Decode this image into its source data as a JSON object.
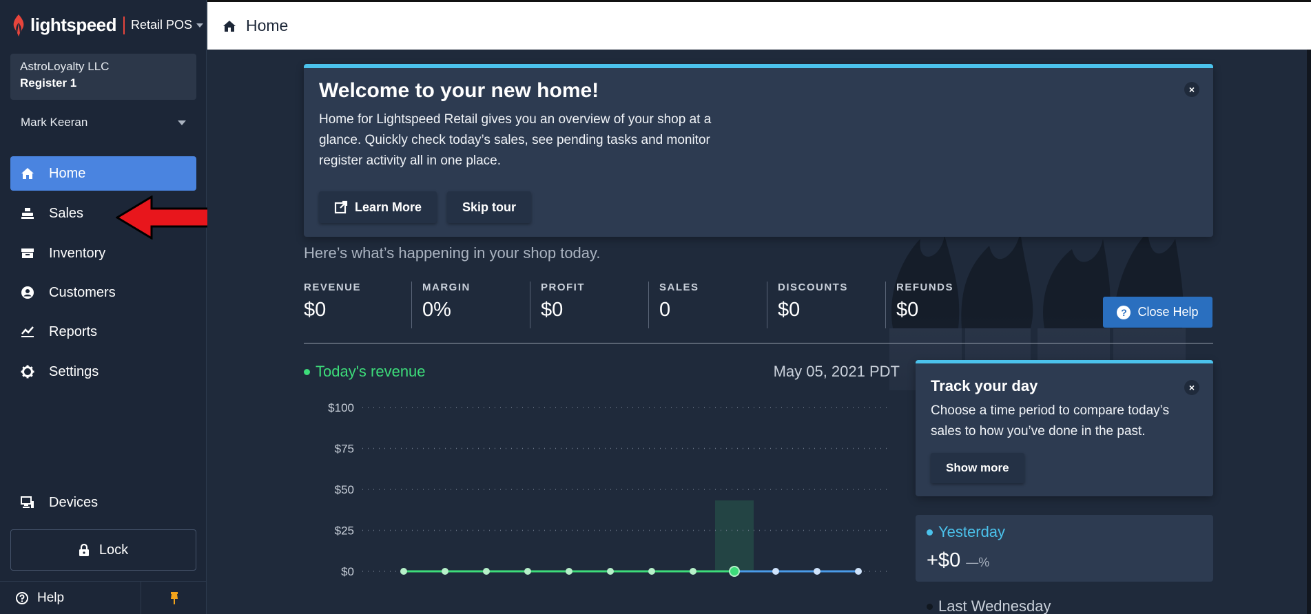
{
  "sidebar": {
    "logo_text": "lightspeed",
    "product": "Retail POS",
    "company": "AstroLoyalty LLC",
    "register": "Register 1",
    "user": "Mark Keeran",
    "nav": [
      {
        "label": "Home",
        "icon": "home-icon",
        "active": true
      },
      {
        "label": "Sales",
        "icon": "register-icon"
      },
      {
        "label": "Inventory",
        "icon": "inventory-icon"
      },
      {
        "label": "Customers",
        "icon": "customers-icon"
      },
      {
        "label": "Reports",
        "icon": "reports-icon"
      },
      {
        "label": "Settings",
        "icon": "gear-icon"
      }
    ],
    "devices": "Devices",
    "lock": "Lock",
    "help": "Help"
  },
  "header": {
    "title": "Home"
  },
  "welcome": {
    "title": "Welcome to your new home!",
    "body": "Home for Lightspeed Retail gives you an overview of your shop at a glance. Quickly check today’s sales, see pending tasks and monitor register activity all in one place.",
    "learn_more": "Learn More",
    "skip_tour": "Skip tour",
    "close": "×"
  },
  "tagline": "Here’s what’s happening in your shop today.",
  "metrics": [
    {
      "label": "REVENUE",
      "value": "$0"
    },
    {
      "label": "MARGIN",
      "value": "0%"
    },
    {
      "label": "PROFIT",
      "value": "$0"
    },
    {
      "label": "SALES",
      "value": "0"
    },
    {
      "label": "DISCOUNTS",
      "value": "$0"
    },
    {
      "label": "REFUNDS",
      "value": "$0"
    }
  ],
  "close_help": "Close Help",
  "revenue": {
    "label": "Today's revenue",
    "date": "May 05, 2021 PDT"
  },
  "chart_data": {
    "type": "line",
    "y_ticks": [
      "$100",
      "$75",
      "$50",
      "$25",
      "$0"
    ],
    "ylim": [
      0,
      100
    ],
    "series": [
      {
        "values": [
          0,
          0,
          0,
          0,
          0,
          0,
          0,
          0,
          0,
          0,
          0,
          0
        ]
      }
    ],
    "highlight_index": 8,
    "colors": {
      "past": "#3ddc7a",
      "future": "#4a9be8"
    }
  },
  "track": {
    "title": "Track your day",
    "body": "Choose a time period to compare today’s sales to how you’ve done in the past.",
    "show_more": "Show more",
    "close": "×"
  },
  "yesterday": {
    "label": "Yesterday",
    "amount": "+$0",
    "pct": "—%"
  },
  "last_wednesday": "Last Wednesday",
  "colors": {
    "accent": "#4a84e0",
    "cyan": "#4bc2ec",
    "green": "#3ddc7a",
    "brand": "#e8453c"
  }
}
